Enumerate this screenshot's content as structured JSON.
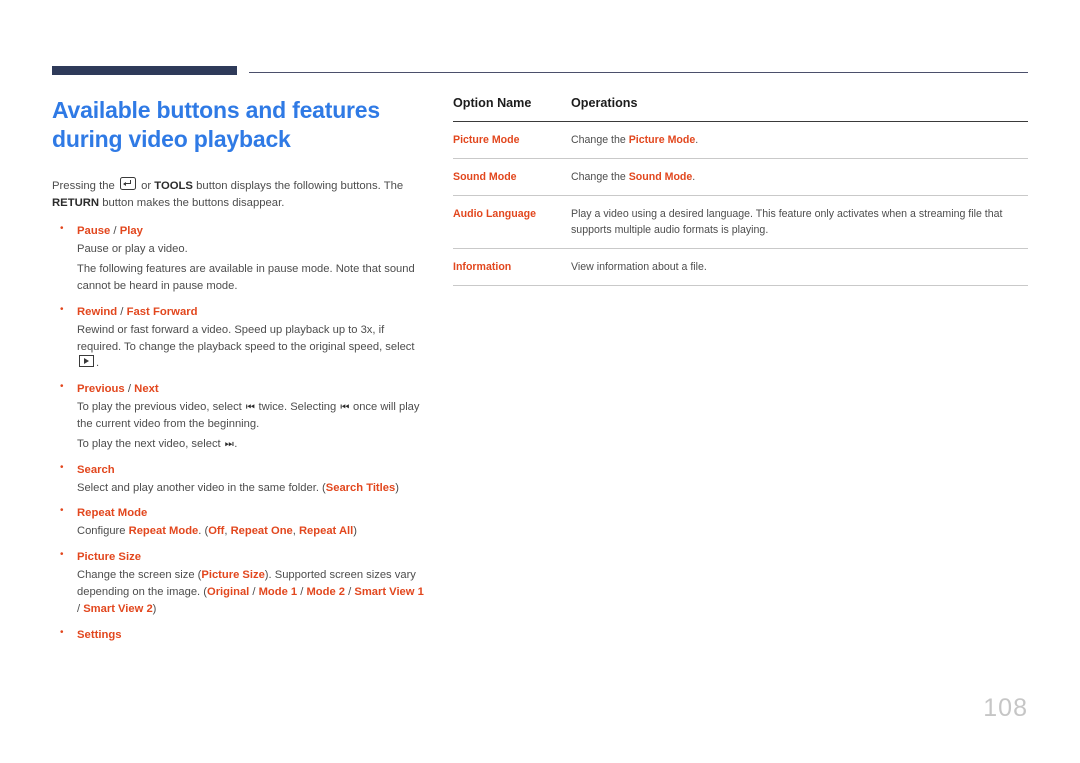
{
  "document": {
    "page_number": "108",
    "accent_color": "#e2471e",
    "title_color": "#2f7ae5",
    "rule_color": "#2e3a59"
  },
  "left": {
    "title_line1": "Available buttons and features",
    "title_line2": "during video playback",
    "intro": {
      "part1": "Pressing the ",
      "icon1": "enter-key-icon",
      "part2": " or ",
      "bold1": "TOOLS",
      "part3": " button displays the following buttons. The ",
      "bold2": "RETURN",
      "part4": " button makes the buttons disappear."
    },
    "bullets": [
      {
        "head_a": "Pause",
        "head_sep": " / ",
        "head_b": "Play",
        "body1": "Pause or play a video.",
        "body2": "The following features are available in pause mode. Note that sound cannot be heard in pause mode."
      },
      {
        "head_a": "Rewind",
        "head_sep": " / ",
        "head_b": "Fast Forward",
        "body1_a": "Rewind or fast forward a video. Speed up playback up to 3x, if required. To change the playback speed to the original speed, select ",
        "body1_icon": "play-box-icon",
        "body1_b": "."
      },
      {
        "head_a": "Previous",
        "head_sep": " / ",
        "head_b": "Next",
        "body1_a": "To play the previous video, select ",
        "body1_icon1": "⏮",
        "body1_b": " twice. Selecting ",
        "body1_icon2": "⏮",
        "body1_c": " once will play the current video from the beginning.",
        "body2_a": "To play the next video, select ",
        "body2_icon": "⏭",
        "body2_b": "."
      },
      {
        "head_a": "Search",
        "body1_a": "Select and play another video in the same folder. (",
        "body1_hl": "Search Titles",
        "body1_b": ")"
      },
      {
        "head_a": "Repeat Mode",
        "body1_a": "Configure ",
        "body1_hl1": "Repeat Mode",
        "body1_b": ". (",
        "body1_hl2": "Off",
        "body1_c": ", ",
        "body1_hl3": "Repeat One",
        "body1_d": ", ",
        "body1_hl4": "Repeat All",
        "body1_e": ")"
      },
      {
        "head_a": "Picture Size",
        "body1_a": "Change the screen size (",
        "body1_hl1": "Picture Size",
        "body1_b": "). Supported screen sizes vary depending on the image. (",
        "body1_hl2": "Original",
        "body1_c": " / ",
        "body1_hl3": "Mode 1",
        "body1_d": " / ",
        "body1_hl4": "Mode 2",
        "body1_e": " / ",
        "body1_hl5": "Smart View 1",
        "body1_f": " / ",
        "body1_hl6": "Smart View 2",
        "body1_g": ")"
      },
      {
        "head_a": "Settings"
      }
    ]
  },
  "right": {
    "table": {
      "headers": [
        "Option Name",
        "Operations"
      ],
      "rows": [
        {
          "name": "Picture Mode",
          "desc_a": "Change the ",
          "desc_hl": "Picture Mode",
          "desc_b": "."
        },
        {
          "name": "Sound Mode",
          "desc_a": "Change the ",
          "desc_hl": "Sound Mode",
          "desc_b": "."
        },
        {
          "name": "Audio Language",
          "desc_a": "Play a video using a desired language. This feature only activates when a streaming file that supports multiple audio formats is playing.",
          "desc_hl": "",
          "desc_b": ""
        },
        {
          "name": "Information",
          "desc_a": "View information about a file.",
          "desc_hl": "",
          "desc_b": ""
        }
      ]
    }
  }
}
